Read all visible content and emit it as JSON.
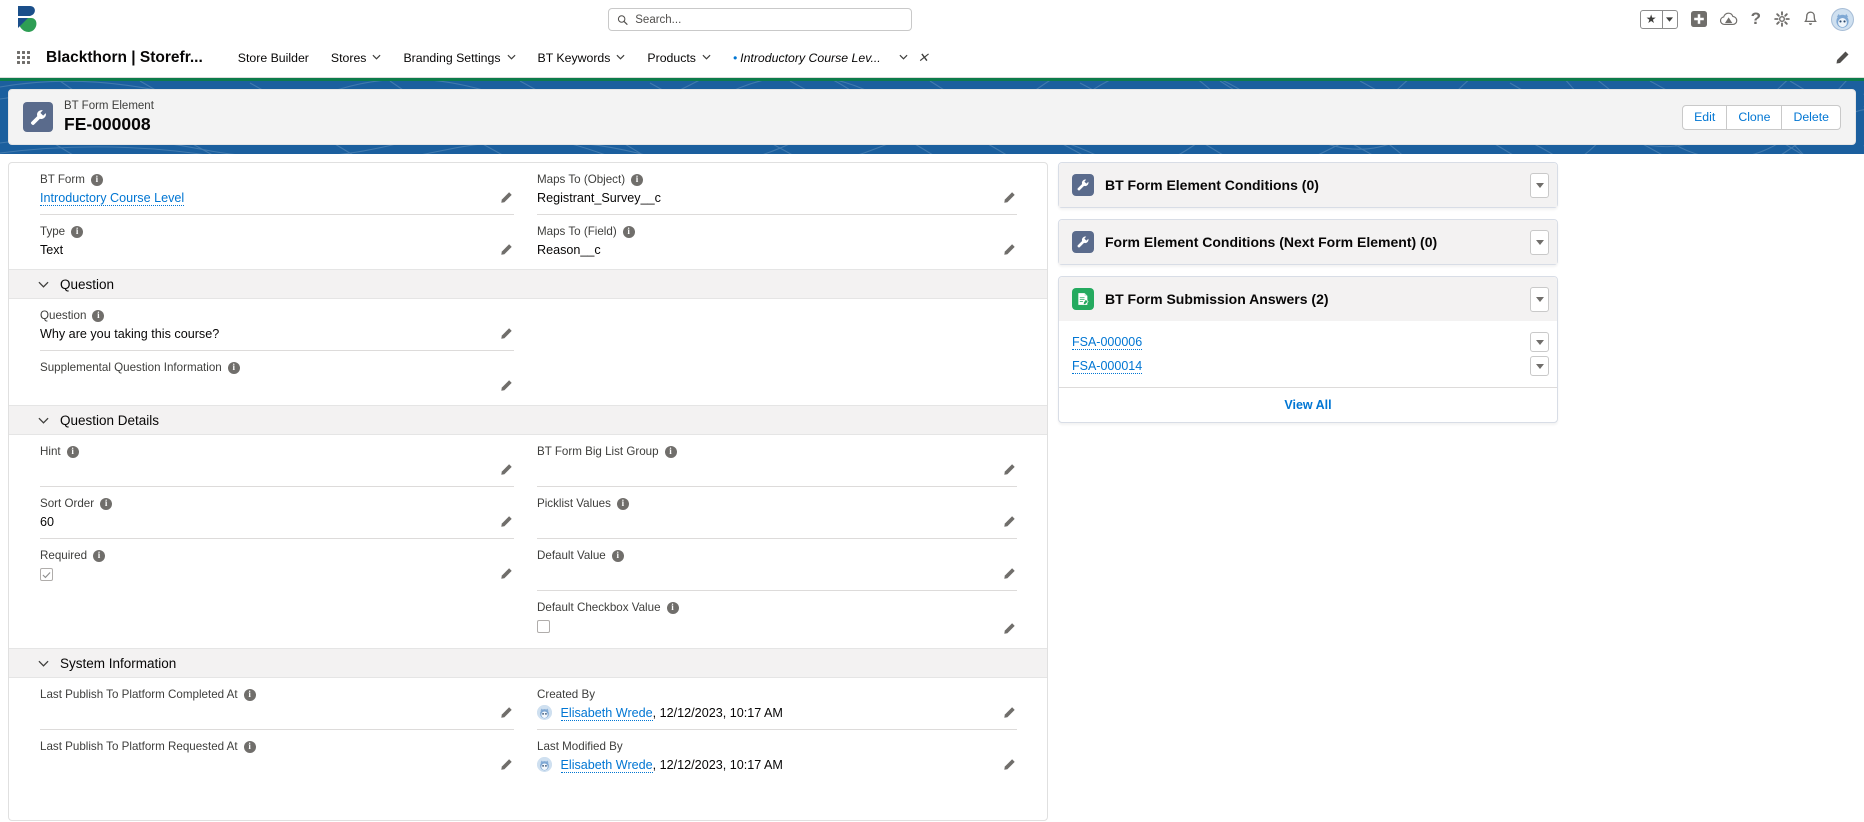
{
  "global_header": {
    "logo": "blackthorn-logo",
    "search": {
      "placeholder": "Search...",
      "value": "",
      "icon": "search-icon"
    },
    "icons": [
      {
        "name": "favorites-star-icon",
        "glyph": "★"
      },
      {
        "name": "favorites-dropdown-icon",
        "glyph": "▾"
      },
      {
        "name": "global-actions-plus-icon",
        "glyph": "+"
      },
      {
        "name": "app-launcher-cloud-icon",
        "glyph": "☁"
      },
      {
        "name": "help-icon",
        "glyph": "?"
      },
      {
        "name": "setup-gear-icon",
        "glyph": "⚙"
      },
      {
        "name": "notifications-bell-icon",
        "glyph": "🔔"
      },
      {
        "name": "user-avatar",
        "glyph": ""
      }
    ]
  },
  "app_nav": {
    "waffle_icon": "app-launcher-waffle-icon",
    "app_name": "Blackthorn | Storefr...",
    "edit_pencil_icon": "edit-nav-pencil-icon",
    "items": [
      {
        "label": "Store Builder",
        "has_caret": false,
        "current": false
      },
      {
        "label": "Stores",
        "has_caret": true,
        "current": false
      },
      {
        "label": "Branding Settings",
        "has_caret": true,
        "current": false
      },
      {
        "label": "BT Keywords",
        "has_caret": true,
        "current": false
      },
      {
        "label": "Products",
        "has_caret": true,
        "current": false
      },
      {
        "label": "Introductory Course Lev...",
        "has_caret": true,
        "current": true,
        "unsaved": true,
        "closable": true
      }
    ]
  },
  "record_header": {
    "icon": "wrench-record-icon",
    "object_label": "BT Form Element",
    "record_name": "FE-000008",
    "actions": [
      {
        "label": "Edit",
        "name": "edit-button"
      },
      {
        "label": "Clone",
        "name": "clone-button"
      },
      {
        "label": "Delete",
        "name": "delete-button"
      }
    ]
  },
  "detail": {
    "top_fields": {
      "left": [
        {
          "label": "BT Form",
          "value": "Introductory Course Level",
          "is_link": true,
          "info": true,
          "editable": true
        },
        {
          "label": "Type",
          "value": "Text",
          "is_link": false,
          "info": true,
          "editable": true
        }
      ],
      "right": [
        {
          "label": "Maps To (Object)",
          "value": "Registrant_Survey__c",
          "is_link": false,
          "info": true,
          "editable": true
        },
        {
          "label": "Maps To (Field)",
          "value": "Reason__c",
          "is_link": false,
          "info": true,
          "editable": true
        }
      ]
    },
    "sections": [
      {
        "title": "Question",
        "expanded": true,
        "left": [
          {
            "label": "Question",
            "value": "Why are you taking this course?",
            "info": true,
            "editable": true
          },
          {
            "label": "Supplemental Question Information",
            "value": "",
            "info": true,
            "editable": true
          }
        ],
        "right": []
      },
      {
        "title": "Question Details",
        "expanded": true,
        "left": [
          {
            "label": "Hint",
            "value": "",
            "info": true,
            "editable": true
          },
          {
            "label": "Sort Order",
            "value": "60",
            "info": true,
            "editable": true
          },
          {
            "label": "Required",
            "value": "",
            "info": true,
            "editable": true,
            "checkbox": true,
            "checked": true
          }
        ],
        "right": [
          {
            "label": "BT Form Big List Group",
            "value": "",
            "info": true,
            "editable": true
          },
          {
            "label": "Picklist Values",
            "value": "",
            "info": true,
            "editable": true
          },
          {
            "label": "Default Value",
            "value": "",
            "info": true,
            "editable": true
          },
          {
            "label": "Default Checkbox Value",
            "value": "",
            "info": true,
            "editable": true,
            "checkbox": true,
            "checked": false
          }
        ]
      },
      {
        "title": "System Information",
        "expanded": true,
        "left": [
          {
            "label": "Last Publish To Platform Completed At",
            "value": "",
            "info": true,
            "editable": true
          },
          {
            "label": "Last Publish To Platform Requested At",
            "value": "",
            "info": true,
            "editable": true
          }
        ],
        "right": [
          {
            "label": "Created By",
            "user": "Elisabeth Wrede",
            "timestamp": ", 12/12/2023, 10:17 AM",
            "info": false,
            "editable": true,
            "avatar": true
          },
          {
            "label": "Last Modified By",
            "user": "Elisabeth Wrede",
            "timestamp": ", 12/12/2023, 10:17 AM",
            "info": false,
            "editable": true,
            "avatar": true
          }
        ]
      }
    ]
  },
  "sidebar": {
    "panels": [
      {
        "title": "BT Form Element Conditions (0)",
        "icon": "wrench-icon",
        "icon_style": "wrench",
        "rows": [],
        "footer": null
      },
      {
        "title": "Form Element Conditions (Next Form Element) (0)",
        "icon": "wrench-icon",
        "icon_style": "wrench",
        "rows": [],
        "footer": null
      },
      {
        "title": "BT Form Submission Answers (2)",
        "icon": "document-icon",
        "icon_style": "doc",
        "rows": [
          {
            "label": "FSA-000006"
          },
          {
            "label": "FSA-000014"
          }
        ],
        "footer": "View All"
      }
    ]
  },
  "colors": {
    "brand_blue": "#1b5f9e",
    "link_blue": "#0176d3",
    "header_green": "#0d7c4a",
    "section_bg": "#f3f2f2",
    "record_icon_bg": "#5a6b8c",
    "doc_icon_bg": "#24aa5f"
  }
}
